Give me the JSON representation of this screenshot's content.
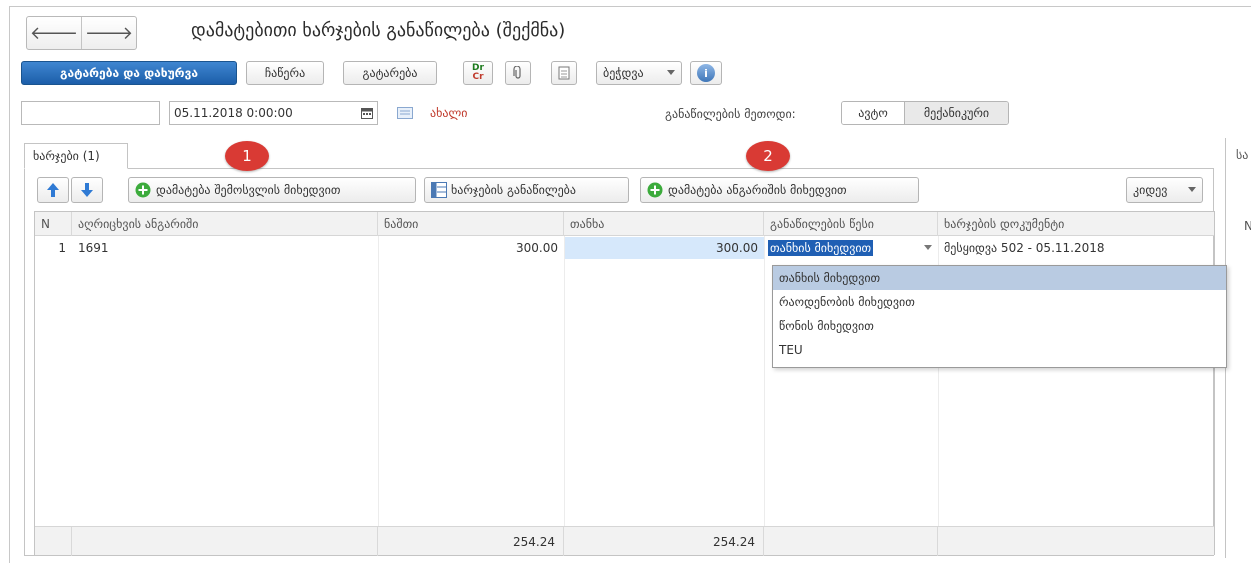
{
  "window": {
    "title": "დამატებითი ხარჯების განაწილება (შექმნა)"
  },
  "nav": {
    "back_glyph": "🡐",
    "forward_glyph": "🡒"
  },
  "toolbar": {
    "save_close_label": "გატარება და დახურვა",
    "write_label": "ჩაწერა",
    "post_label": "გატარება",
    "drcr_label_top": "Dr",
    "drcr_label_bottom": "Cr",
    "more_label": "ბეჭდვა",
    "info_label": "i"
  },
  "header_fields": {
    "number_value": "",
    "date_value": "05.11.2018  0:00:00",
    "status_label": "ახალი",
    "method_label": "განაწილების მეთოდი:",
    "method_options": [
      "ავტო",
      "მექანიკური"
    ],
    "method_selected": "ავტო"
  },
  "tabs": [
    {
      "label": "ხარჯები (1)"
    }
  ],
  "badges": [
    "1",
    "2"
  ],
  "table_toolbar": {
    "add_by_receipt_label": "დამატება შემოსვლის მიხედვით",
    "distribute_costs_label": "ხარჯების განაწილება",
    "add_by_account_label": "დამატება ანგარიშის მიხედვით",
    "more_label": "კიდევ"
  },
  "table": {
    "columns": [
      "N",
      "აღრიცხვის ანგარიში",
      "ნაშთი",
      "თანხა",
      "განაწილების წესი",
      "ხარჯების დოკუმენტი"
    ],
    "rows": [
      {
        "n": "1",
        "account": "1691",
        "balance": "300.00",
        "amount": "300.00",
        "rule": "თანხის მიხედვით",
        "document": "მესყიდვა 502 - 05.11.2018"
      }
    ],
    "footer": {
      "balance_total": "254.24",
      "amount_total": "254.24"
    }
  },
  "dropdown": {
    "options": [
      "თანხის მიხედვით",
      "რაოდენობის მიხედვით",
      "წონის მიხედვით",
      "TEU"
    ],
    "selected_index": 0
  },
  "right_panel": {
    "tab_fragment": "სა",
    "header_fragment": "N"
  },
  "colors": {
    "primary": "#2a6fbd",
    "badge": "#d93a34",
    "selection": "#b9cbe2",
    "amount_cell": "#d6e8fb",
    "status_text": "#c0392b"
  }
}
